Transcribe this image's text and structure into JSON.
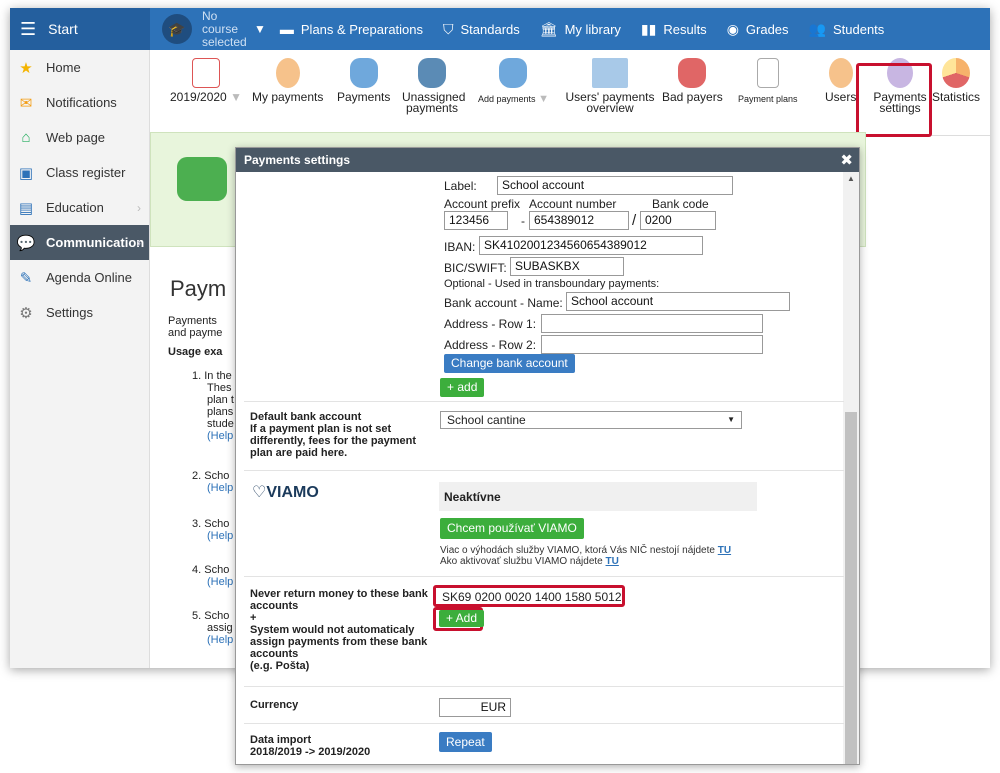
{
  "topbar": {
    "start_label": "Start",
    "course_label": "No course selected",
    "nav": [
      {
        "label": "Plans & Preparations",
        "icon": "briefcase-icon"
      },
      {
        "label": "Standards",
        "icon": "shield-icon"
      },
      {
        "label": "My library",
        "icon": "library-icon"
      },
      {
        "label": "Results",
        "icon": "bar-chart-icon"
      },
      {
        "label": "Grades",
        "icon": "grades-icon"
      },
      {
        "label": "Students",
        "icon": "students-icon"
      }
    ]
  },
  "sidebar": {
    "items": [
      {
        "label": "Home",
        "icon": "star-icon"
      },
      {
        "label": "Notifications",
        "icon": "envelope-icon"
      },
      {
        "label": "Web page",
        "icon": "house-icon"
      },
      {
        "label": "Class register",
        "icon": "register-icon"
      },
      {
        "label": "Education",
        "icon": "book-icon"
      },
      {
        "label": "Communication",
        "icon": "chat-icon"
      },
      {
        "label": "Agenda Online",
        "icon": "pen-icon"
      },
      {
        "label": "Settings",
        "icon": "gear-icon"
      }
    ]
  },
  "toolbar": {
    "year": "2019/2020",
    "items": [
      {
        "label": "My payments"
      },
      {
        "label": "Payments"
      },
      {
        "label": "Unassigned payments"
      },
      {
        "label": "Add payments"
      },
      {
        "label": "Users' payments overview"
      },
      {
        "label": "Bad payers"
      },
      {
        "label": "Payment plans"
      },
      {
        "label": "Users"
      },
      {
        "label": "Payments settings"
      },
      {
        "label": "Statistics"
      }
    ]
  },
  "page": {
    "title": "Paym",
    "text": "Payments and payme",
    "usage": "Usage exa",
    "list": [
      {
        "num": "1.",
        "lines": [
          "In the",
          "Thes",
          "plan t",
          "plans",
          "stude"
        ],
        "help": "(Help"
      },
      {
        "num": "2.",
        "lines": [
          "Scho"
        ],
        "help": "(Help"
      },
      {
        "num": "3.",
        "lines": [
          "Scho"
        ],
        "help": "(Help"
      },
      {
        "num": "4.",
        "lines": [
          "Scho"
        ],
        "help": "(Help"
      },
      {
        "num": "5.",
        "lines": [
          "Scho",
          "assig"
        ],
        "help": "(Help"
      }
    ]
  },
  "modal": {
    "title": "Payments settings",
    "label_label": "Label:",
    "label_value": "School account",
    "account_prefix_label": "Account prefix",
    "account_number_label": "Account number",
    "bank_code_label": "Bank code",
    "account_prefix": "123456",
    "dash": "-",
    "account_number": "654389012",
    "slash": "/",
    "bank_code": "0200",
    "iban_label": "IBAN:",
    "iban_value": "SK4102001234560654389012",
    "bic_label": "BIC/SWIFT:",
    "bic_value": "SUBASKBX",
    "optional_note": "Optional - Used in transboundary payments:",
    "bank_name_label": "Bank account - Name:",
    "bank_name_value": "School account",
    "address1_label": "Address - Row 1:",
    "address2_label": "Address - Row 2:",
    "change_bank_button": "Change bank account",
    "add_button": "+ add",
    "default_bank_label": "Default bank account",
    "default_bank_desc": "If a payment plan is not set differently, fees for the payment plan are paid here.",
    "default_bank_value": "School cantine",
    "viamo_logo": "VIAMO",
    "viamo_status": "Neaktívne",
    "viamo_button": "Chcem používať VIAMO",
    "viamo_note1": "Viac o výhodách služby VIAMO, ktorá Vás NIČ nestojí nájdete",
    "viamo_note2": "Ako aktivovať službu VIAMO nájdete",
    "tu_link": "TU",
    "never_return_label": "Never return money to these bank accounts",
    "plus": "+",
    "never_return_label2": "System would not automaticaly assign payments from these bank accounts",
    "never_return_example": "(e.g. Pošta)",
    "never_return_value": "SK69 0200 0020 1400 1580 5012",
    "add_button2": "+ Add",
    "currency_label": "Currency",
    "currency_value": "EUR",
    "import_label": "Data import",
    "import_years": "2018/2019 -> 2019/2020",
    "repeat_button": "Repeat"
  },
  "colors": {
    "brand_blue": "#2d72b8",
    "highlight_red": "#c8102e",
    "green_button": "#3cae3c",
    "dark_header": "#4a5866"
  }
}
